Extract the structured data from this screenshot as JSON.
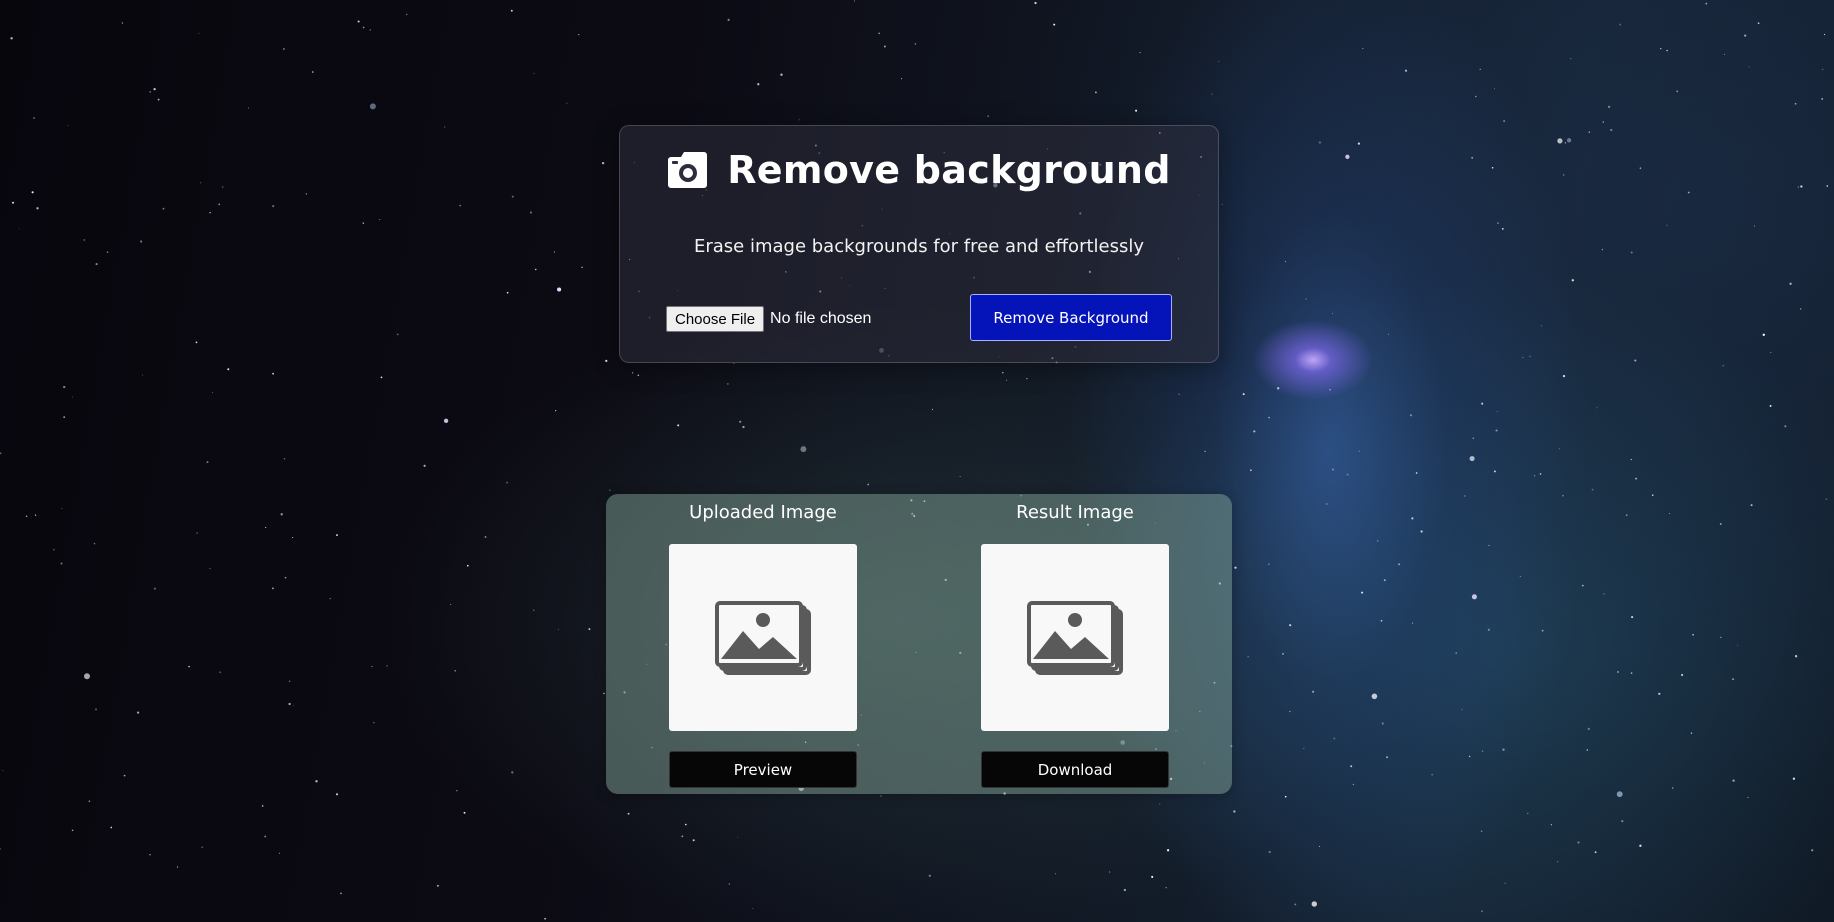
{
  "header": {
    "title": "Remove background",
    "subtitle": "Erase image backgrounds for free and effortlessly",
    "icon": "camera-icon"
  },
  "upload": {
    "choose_file_label": "Choose File",
    "no_file_text": "No file chosen",
    "remove_button_label": "Remove Background"
  },
  "panels": {
    "uploaded": {
      "title": "Uploaded Image",
      "placeholder_icon": "image-placeholder-icon",
      "button_label": "Preview"
    },
    "result": {
      "title": "Result Image",
      "placeholder_icon": "image-placeholder-icon",
      "button_label": "Download"
    }
  },
  "colors": {
    "primary_button": "#0514b8",
    "dark_button": "#060606",
    "placeholder_icon": "#5a5a5a"
  }
}
